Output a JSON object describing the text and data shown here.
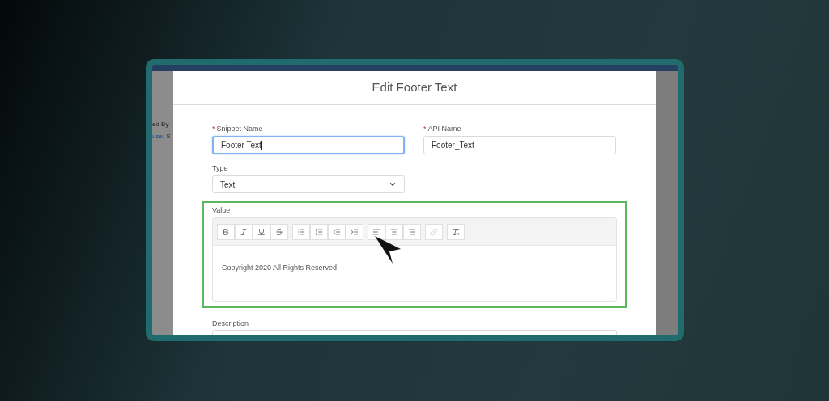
{
  "background_page": {
    "label": "ed By",
    "link": "use",
    "rest": ", S"
  },
  "modal": {
    "title": "Edit Footer Text"
  },
  "fields": [
    {
      "marker": "*",
      "label": "Snippet Name",
      "value": "Footer Text",
      "focused": true
    },
    {
      "marker": "*",
      "label": "API Name",
      "value": "Footer_Text",
      "focused": false
    }
  ],
  "type_field": {
    "label": "Type",
    "value": "Text"
  },
  "value_editor": {
    "label": "Value",
    "highlighted": true,
    "content": "Copyright 2020 All Rights Reserved",
    "toolbar": [
      [
        {
          "kind": "bold",
          "disabled": false
        },
        {
          "kind": "italic",
          "disabled": false
        },
        {
          "kind": "underline",
          "disabled": false
        },
        {
          "kind": "strikethrough",
          "disabled": false
        }
      ],
      [
        {
          "kind": "bullets",
          "disabled": false
        },
        {
          "kind": "numbers",
          "disabled": false
        },
        {
          "kind": "outdent",
          "disabled": false
        },
        {
          "kind": "indent",
          "disabled": false
        }
      ],
      [
        {
          "kind": "align-left",
          "disabled": false
        },
        {
          "kind": "align-center",
          "disabled": false
        },
        {
          "kind": "align-right",
          "disabled": false
        }
      ],
      [
        {
          "kind": "link",
          "disabled": true
        }
      ],
      [
        {
          "kind": "clear-format",
          "disabled": false
        }
      ]
    ]
  },
  "description": {
    "label": "Description"
  }
}
